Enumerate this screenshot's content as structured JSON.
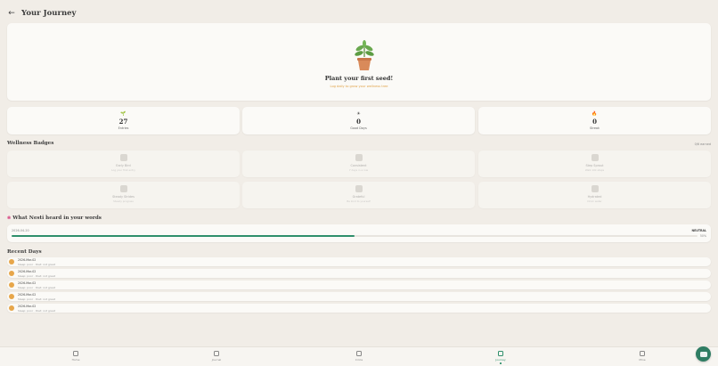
{
  "header": {
    "title": "Your Journey",
    "back_icon": "arrow-left-icon"
  },
  "hero": {
    "icon": "potted-plant-icon",
    "title": "Plant your first seed!",
    "subtitle": "Log daily to grow your wellness tree"
  },
  "stats": [
    {
      "icon": "seedling-icon",
      "value": "27",
      "label": "Entries"
    },
    {
      "icon": "sun-icon",
      "value": "0",
      "label": "Good Days"
    },
    {
      "icon": "flame-icon",
      "value": "0",
      "label": "Streak"
    }
  ],
  "badges_section": {
    "title": "Wellness Badges",
    "earned": "0/6 earned"
  },
  "badges": [
    {
      "icon": "journal-icon",
      "name": "Early Bird",
      "desc": "Log your first entry"
    },
    {
      "icon": "box-icon",
      "name": "Consistent",
      "desc": "7 days in a row"
    },
    {
      "icon": "runner-icon",
      "name": "Step Sprout",
      "desc": "Walk 10k steps"
    },
    {
      "icon": "meditation-icon",
      "name": "Steady Strides",
      "desc": "Steady progress"
    },
    {
      "icon": "heart-icon",
      "name": "Grateful",
      "desc": "Be kind to yourself"
    },
    {
      "icon": "water-drop-icon",
      "name": "Hydrated",
      "desc": "Drink water"
    }
  ],
  "words_section": {
    "title": "What Nesti heard in your words",
    "icon": "brain-icon",
    "date": "2026-04-20",
    "mood": "NEUTRAL",
    "percent": "50%",
    "progress": 0.5
  },
  "recent_section": {
    "title": "Recent Days"
  },
  "recent_days": [
    {
      "date": "2026-Mar-02",
      "summary": "Sleep: poor · Diet: not great"
    },
    {
      "date": "2026-Mar-02",
      "summary": "Sleep: poor · Diet: not great"
    },
    {
      "date": "2026-Mar-02",
      "summary": "Sleep: poor · Diet: not great"
    },
    {
      "date": "2026-Mar-02",
      "summary": "Sleep: poor · Diet: not great"
    },
    {
      "date": "2026-Mar-02",
      "summary": "Sleep: poor · Diet: not great"
    }
  ],
  "nav": [
    {
      "icon": "home-icon",
      "label": "Home"
    },
    {
      "icon": "book-icon",
      "label": "Journal"
    },
    {
      "icon": "people-icon",
      "label": "Circle"
    },
    {
      "icon": "sprout-icon",
      "label": "Journey",
      "active": true
    },
    {
      "icon": "heart-icon",
      "label": "Mine"
    }
  ],
  "fab": {
    "icon": "robot-icon"
  },
  "colors": {
    "accent": "#2f8f6b",
    "highlight": "#e0a34a",
    "background": "#f1ede7"
  }
}
